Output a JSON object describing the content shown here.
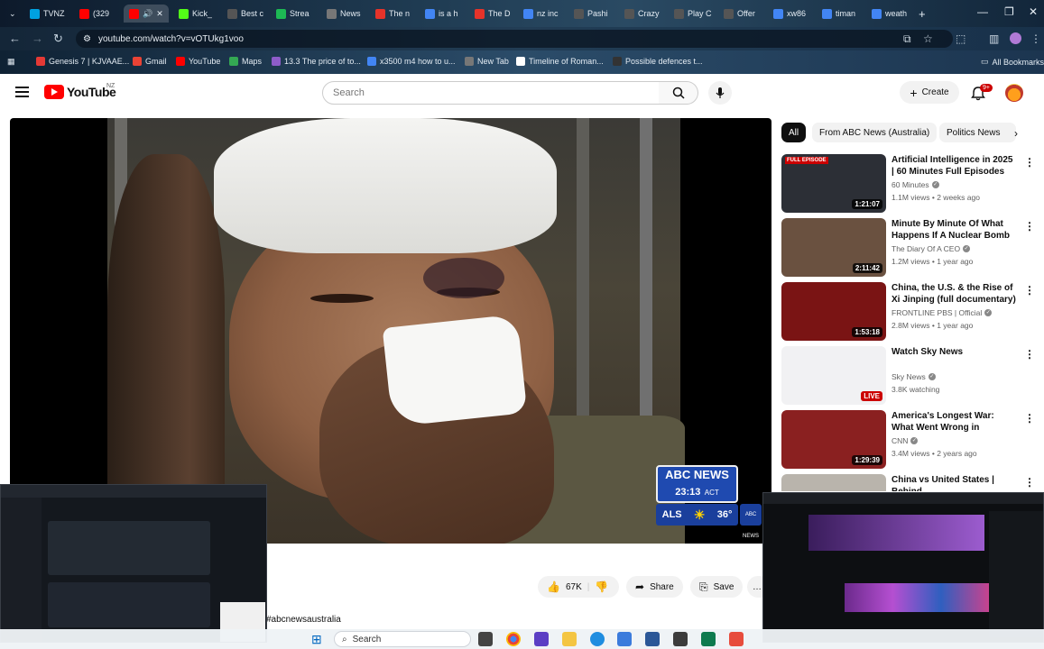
{
  "browser": {
    "tabs": [
      {
        "label": "TVNZ",
        "color": "#00a1e0"
      },
      {
        "label": "(329",
        "color": "#ff0000"
      },
      {
        "label": "",
        "color": "#ff0000"
      },
      {
        "label": "Kick_",
        "color": "#53fc18"
      },
      {
        "label": "Best c",
        "color": "#555555"
      },
      {
        "label": "Strea",
        "color": "#1db954"
      },
      {
        "label": "News",
        "color": "#777777"
      },
      {
        "label": "The n",
        "color": "#e6332a"
      },
      {
        "label": "is a h",
        "color": "#4285f4"
      },
      {
        "label": "The D",
        "color": "#e6332a"
      },
      {
        "label": "nz inc",
        "color": "#4285f4"
      },
      {
        "label": "Pashi",
        "color": "#555555"
      },
      {
        "label": "Crazy",
        "color": "#555555"
      },
      {
        "label": "Play C",
        "color": "#555555"
      },
      {
        "label": "Offer",
        "color": "#555555"
      },
      {
        "label": "xw86",
        "color": "#4285f4"
      },
      {
        "label": "timan",
        "color": "#4285f4"
      },
      {
        "label": "weath",
        "color": "#4285f4"
      }
    ],
    "url": "youtube.com/watch?v=vOTUkg1voo",
    "bookmarks": [
      {
        "label": "Genesis 7 | KJVAAE...",
        "color": "#e53935"
      },
      {
        "label": "Gmail",
        "color": "#ea4335"
      },
      {
        "label": "YouTube",
        "color": "#ff0000"
      },
      {
        "label": "Maps",
        "color": "#34a853"
      },
      {
        "label": "13.3 The price of to...",
        "color": "#8e5cc9"
      },
      {
        "label": "x3500 m4 how to u...",
        "color": "#4285f4"
      },
      {
        "label": "New Tab",
        "color": "#777777"
      },
      {
        "label": "Timeline of Roman...",
        "color": "#ffffff"
      },
      {
        "label": "Possible defences t...",
        "color": "#333333"
      }
    ],
    "all_bookmarks_label": "All Bookmarks"
  },
  "youtube": {
    "logo_text": "YouTube",
    "country": "NZ",
    "search_placeholder": "Search",
    "create_label": "Create",
    "notification_count": "9+"
  },
  "player": {
    "overlay": {
      "brand": "ABC NEWS",
      "time": "23:13",
      "zone": "ACT",
      "location": "ALS",
      "temperature": "36°",
      "mini": "ABC NEWS"
    }
  },
  "actions": {
    "likes": "67K",
    "share": "Share",
    "save": "Save",
    "hashtag": "#abcnewsaustralia"
  },
  "chips": [
    "All",
    "From ABC News (Australia)",
    "Politics News"
  ],
  "recommendations": [
    {
      "title": "Artificial Intelligence in 2025 | 60 Minutes Full Episodes",
      "channel": "60 Minutes",
      "verified": true,
      "meta": "1.1M views • 2 weeks ago",
      "duration": "1:21:07",
      "badge": "FULL EPISODE",
      "thumb_color": "#2c2f36"
    },
    {
      "title": "Minute By Minute Of What Happens If A Nuclear Bomb ...",
      "channel": "The Diary Of A CEO",
      "verified": true,
      "meta": "1.2M views • 1 year ago",
      "duration": "2:11:42",
      "badge": "",
      "thumb_color": "#6a5140"
    },
    {
      "title": "China, the U.S. & the Rise of Xi Jinping (full documentary) | ...",
      "channel": "FRONTLINE PBS | Official",
      "verified": true,
      "meta": "2.8M views • 1 year ago",
      "duration": "1:53:18",
      "badge": "",
      "thumb_color": "#7a1414"
    },
    {
      "title": "Watch Sky News",
      "channel": "Sky News",
      "verified": true,
      "meta": "3.8K watching",
      "duration": "LIVE",
      "badge": "",
      "thumb_color": "#f1f1f3"
    },
    {
      "title": "America's Longest War: What Went Wrong in Afghanistan ...",
      "channel": "CNN",
      "verified": true,
      "meta": "3.4M views • 2 years ago",
      "duration": "1:29:39",
      "badge": "",
      "thumb_color": "#8a2020"
    },
    {
      "title": "China vs United States | Behind",
      "channel": "",
      "verified": false,
      "meta": "",
      "duration": "",
      "badge": "",
      "thumb_color": "#b9b4ac"
    }
  ],
  "taskbar": {
    "search_label": "Search"
  }
}
